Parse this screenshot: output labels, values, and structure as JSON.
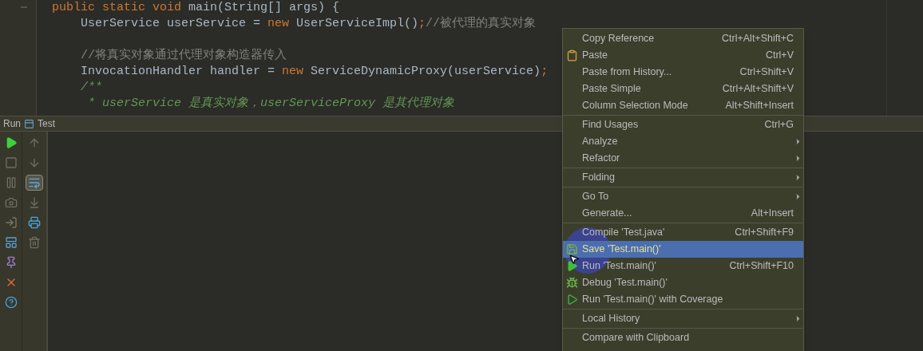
{
  "editor": {
    "lines": [
      {
        "tokens": [
          {
            "kind": "keyword",
            "text": "public static void "
          },
          {
            "kind": "plain",
            "text": "main(String[] args) {"
          }
        ]
      },
      {
        "tokens": [
          {
            "kind": "plain",
            "text": "    UserService userService = "
          },
          {
            "kind": "keyword",
            "text": "new"
          },
          {
            "kind": "plain",
            "text": " UserServiceImpl()"
          },
          {
            "kind": "keyword",
            "text": ";"
          },
          {
            "kind": "comment",
            "text": "//被代理的真实对象"
          }
        ],
        "blank_after": true
      },
      {
        "tokens": [
          {
            "kind": "comment",
            "text": "    //将真实对象通过代理对象构造器传入"
          }
        ]
      },
      {
        "tokens": [
          {
            "kind": "plain",
            "text": "    InvocationHandler handler = "
          },
          {
            "kind": "keyword",
            "text": "new"
          },
          {
            "kind": "plain",
            "text": " ServiceDynamicProxy(userService)"
          },
          {
            "kind": "keyword",
            "text": ";"
          }
        ]
      },
      {
        "tokens": [
          {
            "kind": "doc",
            "text": "    /**"
          }
        ]
      },
      {
        "tokens": [
          {
            "kind": "doc",
            "text": "     * userService 是真实对象，userServiceProxy 是其代理对象"
          }
        ]
      }
    ]
  },
  "run_panel": {
    "title": "Run",
    "tab": "Test",
    "soft_wrap_on": true
  },
  "context_menu": {
    "items": [
      {
        "label": "Copy Reference",
        "shortcut": "Ctrl+Alt+Shift+C",
        "submenu": false,
        "selected": false,
        "separator_after": false
      },
      {
        "label": "Paste",
        "shortcut": "Ctrl+V",
        "submenu": false,
        "selected": false,
        "separator_after": false
      },
      {
        "label": "Paste from History...",
        "shortcut": "Ctrl+Shift+V",
        "submenu": false,
        "selected": false,
        "separator_after": false
      },
      {
        "label": "Paste Simple",
        "shortcut": "Ctrl+Alt+Shift+V",
        "submenu": false,
        "selected": false,
        "separator_after": false
      },
      {
        "label": "Column Selection Mode",
        "shortcut": "Alt+Shift+Insert",
        "submenu": false,
        "selected": false,
        "separator_after": true
      },
      {
        "label": "Find Usages",
        "shortcut": "Ctrl+G",
        "submenu": false,
        "selected": false,
        "separator_after": false
      },
      {
        "label": "Analyze",
        "submenu": true,
        "selected": false,
        "separator_after": false
      },
      {
        "label": "Refactor",
        "submenu": true,
        "selected": false,
        "separator_after": true
      },
      {
        "label": "Folding",
        "submenu": true,
        "selected": false,
        "separator_after": true
      },
      {
        "label": "Go To",
        "submenu": true,
        "selected": false,
        "separator_after": false
      },
      {
        "label": "Generate...",
        "shortcut": "Alt+Insert",
        "submenu": false,
        "selected": false,
        "separator_after": true
      },
      {
        "label": "Compile 'Test.java'",
        "shortcut": "Ctrl+Shift+F9",
        "submenu": false,
        "selected": false,
        "separator_after": false
      },
      {
        "label": "Save 'Test.main()'",
        "submenu": false,
        "selected": true,
        "separator_after": false
      },
      {
        "label": "Run 'Test.main()'",
        "shortcut": "Ctrl+Shift+F10",
        "submenu": false,
        "selected": false,
        "separator_after": false
      },
      {
        "label": "Debug 'Test.main()'",
        "submenu": false,
        "selected": false,
        "separator_after": false
      },
      {
        "label": "Run 'Test.main()' with Coverage",
        "submenu": false,
        "selected": false,
        "separator_after": true
      },
      {
        "label": "Local History",
        "submenu": true,
        "selected": false,
        "separator_after": true
      },
      {
        "label": "Compare with Clipboard",
        "submenu": false,
        "selected": false,
        "separator_after": false
      }
    ]
  }
}
